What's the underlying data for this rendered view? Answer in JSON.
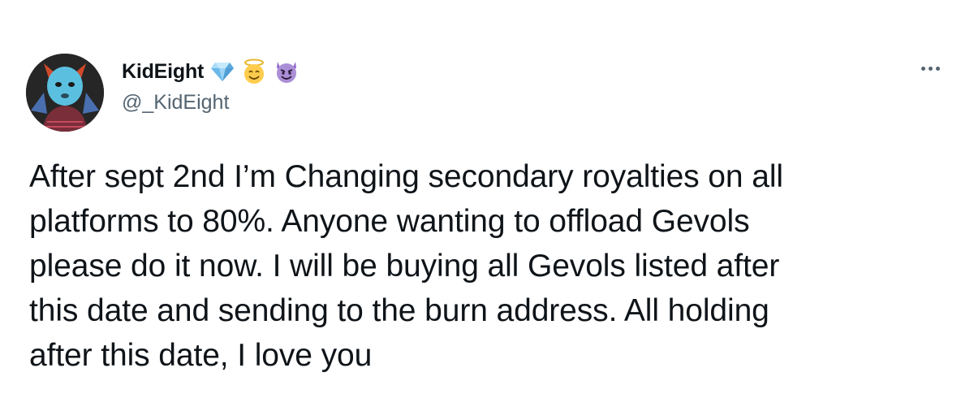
{
  "author": {
    "display_name": "KidEight",
    "handle": "@_KidEight",
    "badges": [
      "gem-icon",
      "smiling-halo-face-icon",
      "smiling-devil-face-icon"
    ]
  },
  "tweet": {
    "text": "After sept 2nd I’m Changing secondary royalties on all\nplatforms to 80%. Anyone wanting to offload Gevols\nplease do it now. I will be buying all Gevols listed after\nthis date and sending to the burn address. All holding\nafter this date, I love you"
  },
  "colors": {
    "text_primary": "#0f1419",
    "text_secondary": "#536471",
    "background": "#ffffff"
  }
}
